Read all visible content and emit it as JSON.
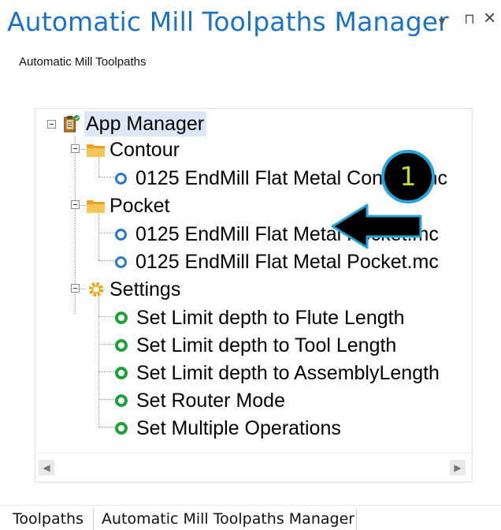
{
  "window": {
    "title": "Automatic Mill Toolpaths Manager",
    "subtitle": "Automatic Mill Toolpaths",
    "icons": [
      "dropdown-icon",
      "pin-icon",
      "close-icon"
    ],
    "icon_glyphs": {
      "dropdown": "▼",
      "pin": "⊓",
      "close": "×"
    }
  },
  "tree": {
    "root": "App Manager",
    "folders": [
      {
        "label": "Contour",
        "items": [
          "0125 EndMill Flat Metal Contour.mc"
        ]
      },
      {
        "label": "Pocket",
        "items": [
          "0125 EndMill Flat Metal Pocket.mc",
          "0125 EndMill Flat Metal Pocket.mc"
        ]
      }
    ],
    "settings": {
      "label": "Settings",
      "items": [
        "Set Limit depth to Flute Length",
        "Set Limit depth to Tool Length",
        "Set Limit depth to AssemblyLength",
        "Set Router Mode",
        "Set Multiple Operations"
      ]
    },
    "scroll": {
      "left": "◀",
      "right": "▶"
    }
  },
  "annotation": {
    "callout_number": "1",
    "callout_color": "#2aa3d9",
    "callout_text_color": "#c6de24"
  },
  "tabs": [
    "Toolpaths",
    "Automatic Mill Toolpaths Manager"
  ],
  "colors": {
    "accent": "#1e73be",
    "selection": "#dde7f5",
    "folder": "#f2b33d",
    "leaf_blue": "#2a78c4",
    "leaf_green": "#1ea13a"
  }
}
